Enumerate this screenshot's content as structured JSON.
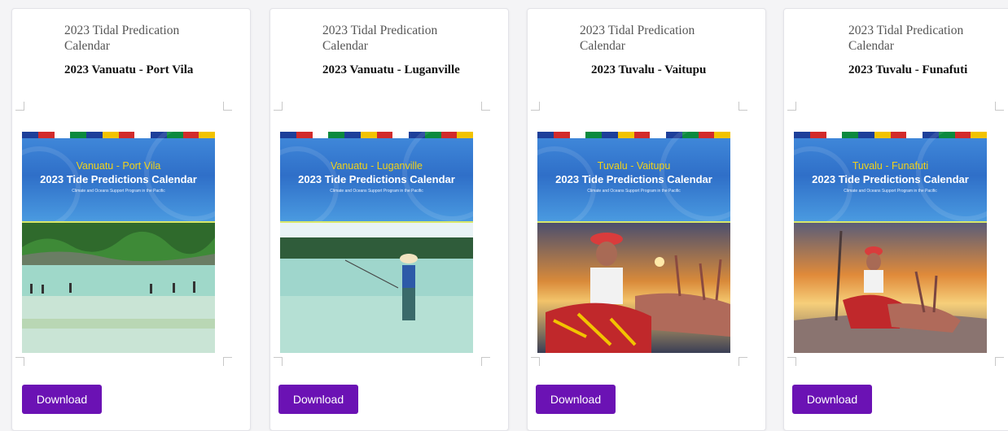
{
  "cards": [
    {
      "subtitle": "2023 Tidal Predication Calendar",
      "title": "2023 Vanuatu - Port Vila",
      "cover_place": "Vanuatu - Port Vila",
      "cover_calendar": "2023 Tide Predictions Calendar",
      "cover_subtitle": "Climate and Oceans Support Program in the Pacific",
      "download_label": "Download"
    },
    {
      "subtitle": "2023 Tidal Predication Calendar",
      "title": "2023 Vanuatu - Luganville",
      "cover_place": "Vanuatu - Luganville",
      "cover_calendar": "2023 Tide Predictions Calendar",
      "cover_subtitle": "Climate and Oceans Support Program in the Pacific",
      "download_label": "Download"
    },
    {
      "subtitle": "2023 Tidal Predication Calendar",
      "title": "2023 Tuvalu - Vaitupu",
      "cover_place": "Tuvalu - Vaitupu",
      "cover_calendar": "2023 Tide Predictions Calendar",
      "cover_subtitle": "Climate and Oceans Support Program in the Pacific",
      "download_label": "Download"
    },
    {
      "subtitle": "2023 Tidal Predication Calendar",
      "title": "2023 Tuvalu - Funafuti",
      "cover_place": "Tuvalu - Funafuti",
      "cover_calendar": "2023 Tide Predictions Calendar",
      "cover_subtitle": "Climate and Oceans Support Program in the Pacific",
      "download_label": "Download"
    }
  ],
  "colors": {
    "download_button": "#6b12b4",
    "cover_place_text": "#f1d21a",
    "cover_background": "#2f6fc8"
  }
}
